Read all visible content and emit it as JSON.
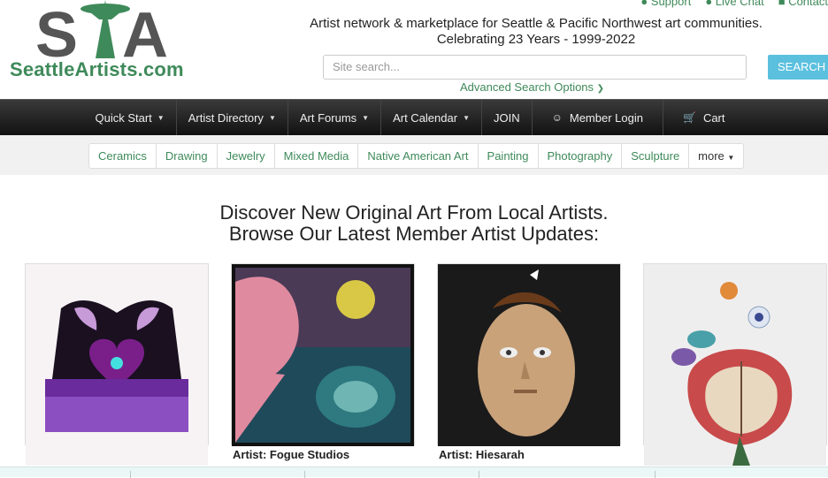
{
  "header": {
    "logo_text": "SeattleArtists.com",
    "logo_mark_letters": "STA",
    "top_links": [
      "Support",
      "Live Chat",
      "Contact"
    ],
    "tagline_line1": "Artist network & marketplace for Seattle & Pacific Northwest art communities.",
    "tagline_line2": "Celebrating 23 Years - 1999-2022",
    "search_placeholder": "Site search...",
    "search_button": "SEARCH",
    "advanced_search": "Advanced Search Options"
  },
  "nav": {
    "items": [
      {
        "label": "Quick Start",
        "caret": true
      },
      {
        "label": "Artist Directory",
        "caret": true
      },
      {
        "label": "Art Forums",
        "caret": true
      },
      {
        "label": "Art Calendar",
        "caret": true
      },
      {
        "label": "JOIN",
        "caret": false
      },
      {
        "label": "Member Login",
        "icon": "user-icon"
      },
      {
        "label": "Cart",
        "icon": "cart-icon"
      }
    ]
  },
  "categories": [
    "Ceramics",
    "Drawing",
    "Jewelry",
    "Mixed Media",
    "Native American Art",
    "Painting",
    "Photography",
    "Sculpture",
    "more"
  ],
  "main": {
    "headline_line1": "Discover New Original Art From Local Artists.",
    "headline_line2": "Browse Our Latest Member Artist Updates:"
  },
  "cards": [
    {
      "artist": ""
    },
    {
      "artist": "Artist: Fogue Studios"
    },
    {
      "artist": "Artist: Hiesarah"
    },
    {
      "artist": ""
    }
  ],
  "colors": {
    "brand_green": "#3f8a5a",
    "search_button": "#5bc0de",
    "navbar": "#222222"
  }
}
